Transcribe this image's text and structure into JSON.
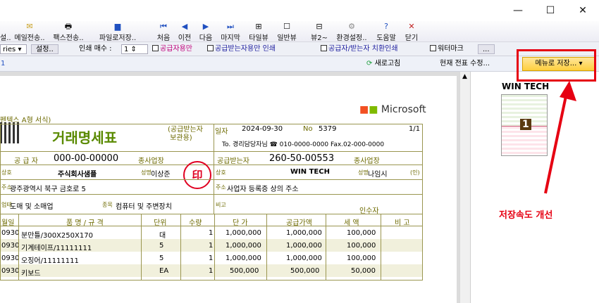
{
  "window": {
    "minimize": "—",
    "maximize": "☐",
    "close": "✕"
  },
  "toolbar": {
    "items": [
      {
        "label": "설..",
        "icon": "doc-icon"
      },
      {
        "label": "메일전송..",
        "icon": "mail-icon"
      },
      {
        "label": "팩스전송..",
        "icon": "fax-icon"
      },
      {
        "label": "파일로저장..",
        "icon": "save-file-icon"
      },
      {
        "label": "처음",
        "icon": "first-icon"
      },
      {
        "label": "이전",
        "icon": "prev-icon"
      },
      {
        "label": "다음",
        "icon": "next-icon"
      },
      {
        "label": "마지막",
        "icon": "last-icon"
      },
      {
        "label": "타일뷰",
        "icon": "tile-icon"
      },
      {
        "label": "일반뷰",
        "icon": "normal-view-icon"
      },
      {
        "label": "뷰2~",
        "icon": "view2-icon"
      },
      {
        "label": "환경설정..",
        "icon": "gear-icon"
      },
      {
        "label": "도움말",
        "icon": "help-icon"
      },
      {
        "label": "닫기",
        "icon": "close-icon"
      }
    ]
  },
  "options": {
    "series_combo": "ries",
    "settings_btn": "설정..",
    "copies_label": "인쇄 매수 :",
    "copies_value": "1",
    "chk_supplier_only": "공급자용만",
    "chk_receiver_only": "공급받는자용만 인쇄",
    "chk_swap": "공급자/받는자 치환인쇄",
    "chk_watermark": "워터마크",
    "more_btn": "..."
  },
  "actions": {
    "left_value": "1",
    "refresh": "새로고침",
    "edit_current": "현재 전표 수정...",
    "save_menu": "메뉴로 저장...",
    "dropdown": "▾"
  },
  "document": {
    "format_name": "펜텍스 A형 서식)",
    "title": "거래명세표",
    "copy_type": "(공급받는자\n 보관용)",
    "date_label": "일자",
    "date_value": "2024-09-30",
    "no_label": "No",
    "no_value": "5379",
    "page": "1/1",
    "to_line": "To. 경리담당자님 ☎ 010-0000-0000 Fax.02-000-0000",
    "supplier_label": "공 급 자",
    "supplier_regno": "000-00-00000",
    "biz_label": "종사업장",
    "receiver_label": "공급받는자",
    "receiver_regno": "260-50-00553",
    "company_label": "상호",
    "supplier_company": "주식회사샘플",
    "name_label": "성명",
    "supplier_name": "이상준",
    "seal": "印",
    "receiver_company": "WIN TECH",
    "receiver_name": "나임시",
    "seal_small": "(인)",
    "address_label": "주소",
    "supplier_address": "광주광역시 북구 금호로 5",
    "receiver_address": "사업자 등록증 상의 주소",
    "type_label": "업태",
    "supplier_type": "도매 및 소매업",
    "item_label": "종목",
    "supplier_item": "컴퓨터 및 주변장치",
    "note_label": "비고",
    "receiver_signer": "인수자",
    "columns": [
      "월일",
      "품 명 / 규 격",
      "단위",
      "수량",
      "단 가",
      "공급가액",
      "세 액",
      "비 고"
    ],
    "rows": [
      {
        "date": "0930",
        "item": "분만틀/300X250X170",
        "unit": "대",
        "qty": "1",
        "price": "1,000,000",
        "amount": "1,000,000",
        "tax": "100,000"
      },
      {
        "date": "0930",
        "item": "기계테이프/11111111",
        "unit": "5",
        "qty": "1",
        "price": "1,000,000",
        "amount": "1,000,000",
        "tax": "100,000"
      },
      {
        "date": "0930",
        "item": "오징어/11111111",
        "unit": "5",
        "qty": "1",
        "price": "1,000,000",
        "amount": "1,000,000",
        "tax": "100,000"
      },
      {
        "date": "0930",
        "item": "키보드",
        "unit": "EA",
        "qty": "1",
        "price": "500,000",
        "amount": "500,000",
        "tax": "50,000"
      }
    ],
    "brand": "Microsoft"
  },
  "preview": {
    "title": "WIN TECH",
    "page_number": "1"
  },
  "annotation": {
    "text": "저장속도 개선"
  },
  "colors": {
    "accent": "#ffcf3e",
    "red": "#e60012",
    "olive": "#6d6a00"
  }
}
